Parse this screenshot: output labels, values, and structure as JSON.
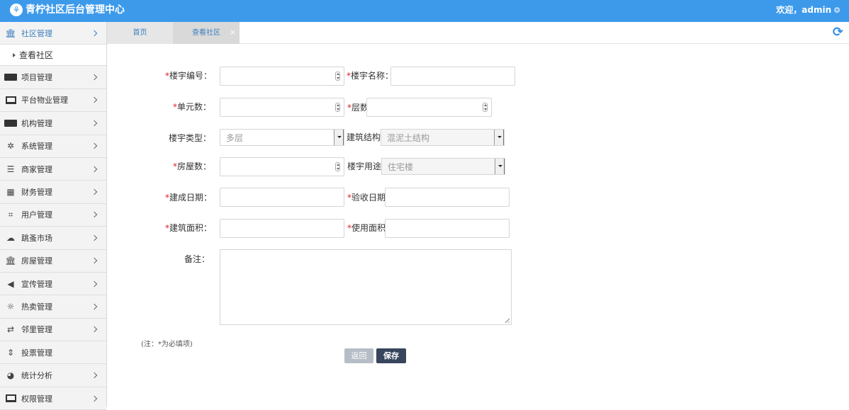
{
  "header": {
    "title": "青柠社区后台管理中心",
    "welcome": "欢迎，admin"
  },
  "sidebar": {
    "items": [
      {
        "label": "社区管理",
        "icon": "bank-icon"
      },
      {
        "label": "项目管理",
        "icon": "discover-card-icon"
      },
      {
        "label": "平台物业管理",
        "icon": "monitor-icon"
      },
      {
        "label": "机构管理",
        "icon": "stripe-icon"
      },
      {
        "label": "系统管理",
        "icon": "yelp-icon"
      },
      {
        "label": "商家管理",
        "icon": "bars-icon"
      },
      {
        "label": "财务管理",
        "icon": "calculator-icon"
      },
      {
        "label": "用户管理",
        "icon": "crop-icon"
      },
      {
        "label": "跳蚤市场",
        "icon": "cloud-icon"
      },
      {
        "label": "房屋管理",
        "icon": "institution-icon"
      },
      {
        "label": "宣传管理",
        "icon": "volume-icon"
      },
      {
        "label": "热卖管理",
        "icon": "sun-icon"
      },
      {
        "label": "邻里管理",
        "icon": "retweet-icon"
      },
      {
        "label": "投票管理",
        "icon": "sort-icon"
      },
      {
        "label": "统计分析",
        "icon": "pie-chart-icon"
      },
      {
        "label": "权限管理",
        "icon": "desktop-icon"
      }
    ],
    "subitem": "查看社区"
  },
  "tabs": [
    {
      "label": "首页"
    },
    {
      "label": "查看社区"
    }
  ],
  "tab_close": "×",
  "form": {
    "building_no": "楼宇编号：",
    "building_name": "楼宇名称：",
    "unit_count": "单元数：",
    "floors": "层数",
    "building_type": "楼宇类型：",
    "building_type_value": "多层",
    "structure": "建筑结构",
    "structure_value": "混泥土结构",
    "house_count": "房屋数：",
    "usage": "楼宇用途",
    "usage_value": "住宅楼",
    "built_date": "建成日期：",
    "accept_date": "验收日期",
    "built_area": "建筑面积：",
    "use_area": "使用面积",
    "remark": "备注：",
    "note": "(注：*为必填项)"
  },
  "buttons": {
    "back": "返回",
    "save": "保存"
  },
  "colors": {
    "header": "#3d9aeb",
    "required": "#e02020",
    "save": "#37465d",
    "back": "#b6bdc6"
  }
}
